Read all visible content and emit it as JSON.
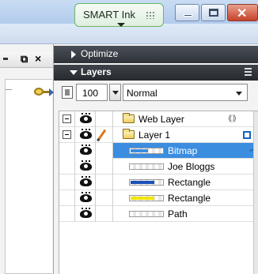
{
  "titlebar": {
    "smart_ink_label": "SMART Ink",
    "close_glyph": "✕"
  },
  "left_panel": {
    "dock_glyph": "⧉",
    "close_glyph": "×"
  },
  "panels": {
    "optimize_label": "Optimize",
    "layers_label": "Layers"
  },
  "layer_controls": {
    "opacity": "100",
    "blend_mode": "Normal"
  },
  "layers": [
    {
      "name": "Web Layer",
      "type": "folder",
      "expander": true,
      "share_icon": "⟪⟫",
      "selected": false
    },
    {
      "name": "Layer 1",
      "type": "folder",
      "expander": true,
      "editing": true,
      "selected_marker": true,
      "selected": false
    },
    {
      "name": "Bitmap",
      "type": "object",
      "thumb_color": "#3b8de0",
      "selected": true
    },
    {
      "name": "Joe Bloggs",
      "type": "object",
      "thumb_color": "",
      "selected": false
    },
    {
      "name": "Rectangle",
      "type": "object",
      "thumb_color": "#1b4fb8",
      "selected": false
    },
    {
      "name": "Rectangle",
      "type": "object",
      "thumb_color": "#f2e400",
      "selected": false
    },
    {
      "name": "Path",
      "type": "object",
      "thumb_color": "",
      "selected": false
    }
  ],
  "colors": {
    "selection": "#3b8de0",
    "panel_header": "#2e3238",
    "rectangle_blue": "#1b4fb8",
    "rectangle_yellow": "#f2e400"
  }
}
